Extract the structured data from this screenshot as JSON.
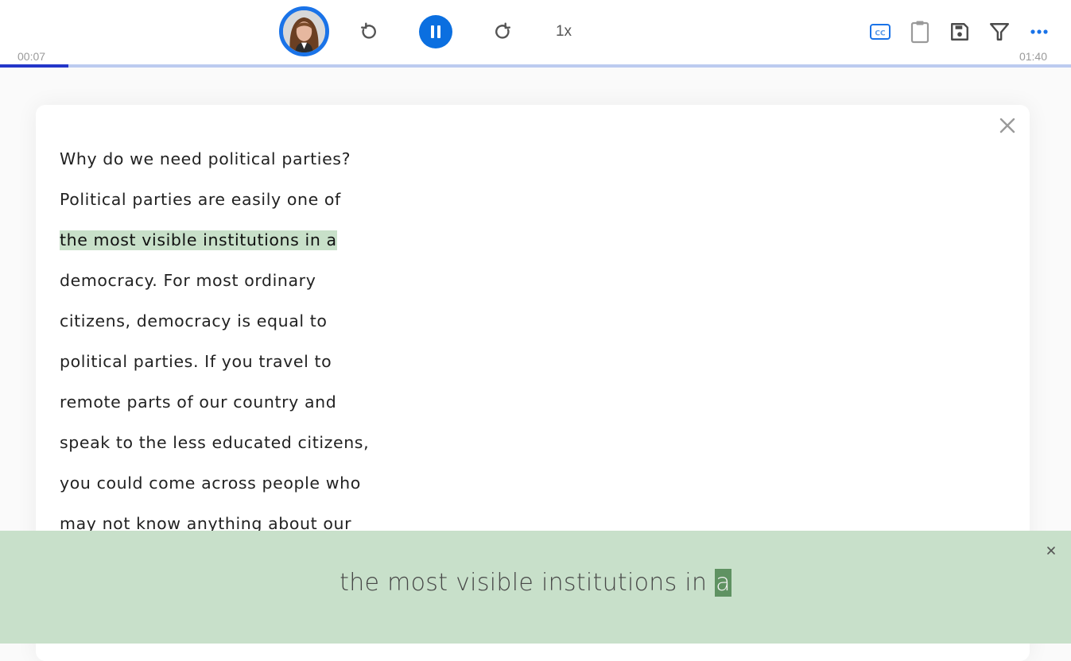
{
  "player": {
    "current_time": "00:07",
    "total_time": "01:40",
    "progress_fraction": 0.064,
    "speed_label": "1x",
    "state": "playing",
    "colors": {
      "accent": "#0b6fe0",
      "progress_fill": "#2336c9",
      "progress_track": "#bccbf0"
    }
  },
  "toolbar": {
    "icons": [
      "closed-captions-icon",
      "clipboard-icon",
      "save-icon",
      "filter-icon",
      "more-icon"
    ],
    "cc_label": "CC"
  },
  "transcript": {
    "lines": [
      {
        "text": "Why do we need political parties?",
        "highlighted": false
      },
      {
        "text": "Political parties are easily one of",
        "highlighted": false
      },
      {
        "text": "the most visible institutions in a",
        "highlighted": true
      },
      {
        "text": "democracy. For most ordinary",
        "highlighted": false
      },
      {
        "text": "citizens, democracy is equal to",
        "highlighted": false
      },
      {
        "text": "political parties. If you travel to",
        "highlighted": false
      },
      {
        "text": "remote parts of our country and",
        "highlighted": false
      },
      {
        "text": "speak to the less educated citizens,",
        "highlighted": false
      },
      {
        "text": "you could come across people who",
        "highlighted": false
      },
      {
        "text": "may not know anything about our",
        "highlighted": false
      }
    ],
    "highlight_color": "#c8e0c9"
  },
  "caption": {
    "text_before": "the most visible institutions in ",
    "current_word": "a",
    "close_label": "×",
    "background": "#c8e0ca",
    "current_word_bg": "#5f9262"
  }
}
